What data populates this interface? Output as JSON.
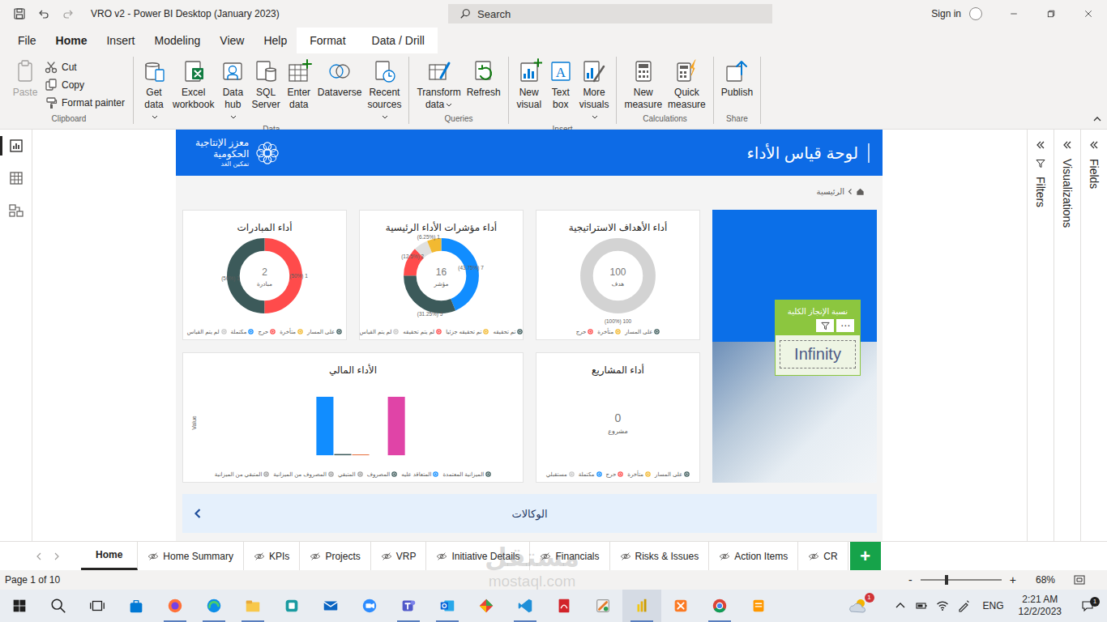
{
  "window": {
    "title": "VRO v2 - Power BI Desktop (January 2023)",
    "search_placeholder": "Search",
    "sign_in": "Sign in"
  },
  "ribbon_tabs": [
    {
      "label": "File",
      "selected": false,
      "contextual": false
    },
    {
      "label": "Home",
      "selected": true,
      "contextual": false
    },
    {
      "label": "Insert",
      "selected": false,
      "contextual": false
    },
    {
      "label": "Modeling",
      "selected": false,
      "contextual": false
    },
    {
      "label": "View",
      "selected": false,
      "contextual": false
    },
    {
      "label": "Help",
      "selected": false,
      "contextual": false
    },
    {
      "label": "Format",
      "selected": false,
      "contextual": true
    },
    {
      "label": "Data / Drill",
      "selected": false,
      "contextual": true
    }
  ],
  "ribbon_groups": [
    {
      "label": "Clipboard",
      "buttons": [
        {
          "label": "Paste",
          "kind": "large",
          "disabled": true,
          "dropdown": false
        },
        {
          "label": "Cut",
          "kind": "small",
          "disabled": false,
          "dropdown": false
        },
        {
          "label": "Copy",
          "kind": "small",
          "disabled": false,
          "dropdown": false
        },
        {
          "label": "Format painter",
          "kind": "small",
          "disabled": false,
          "dropdown": false
        }
      ]
    },
    {
      "label": "Data",
      "buttons": [
        {
          "label": "Get data",
          "kind": "large",
          "disabled": false,
          "dropdown": true
        },
        {
          "label": "Excel workbook",
          "kind": "large",
          "disabled": false,
          "dropdown": false
        },
        {
          "label": "Data hub",
          "kind": "large",
          "disabled": false,
          "dropdown": true
        },
        {
          "label": "SQL Server",
          "kind": "large",
          "disabled": false,
          "dropdown": false
        },
        {
          "label": "Enter data",
          "kind": "large",
          "disabled": false,
          "dropdown": false
        },
        {
          "label": "Dataverse",
          "kind": "large",
          "disabled": false,
          "dropdown": false
        },
        {
          "label": "Recent sources",
          "kind": "large",
          "disabled": false,
          "dropdown": true
        }
      ]
    },
    {
      "label": "Queries",
      "buttons": [
        {
          "label": "Transform data",
          "kind": "large",
          "disabled": false,
          "dropdown": true
        },
        {
          "label": "Refresh",
          "kind": "large",
          "disabled": false,
          "dropdown": false
        }
      ]
    },
    {
      "label": "Insert",
      "buttons": [
        {
          "label": "New visual",
          "kind": "large",
          "disabled": false,
          "dropdown": false
        },
        {
          "label": "Text box",
          "kind": "large",
          "disabled": false,
          "dropdown": false,
          "glyph": "A"
        },
        {
          "label": "More visuals",
          "kind": "large",
          "disabled": false,
          "dropdown": true
        }
      ]
    },
    {
      "label": "Calculations",
      "buttons": [
        {
          "label": "New measure",
          "kind": "large",
          "disabled": false,
          "dropdown": false
        },
        {
          "label": "Quick measure",
          "kind": "large",
          "disabled": false,
          "dropdown": false
        }
      ]
    },
    {
      "label": "Share",
      "buttons": [
        {
          "label": "Publish",
          "kind": "large",
          "disabled": false,
          "dropdown": false
        }
      ]
    }
  ],
  "left_nav": [
    {
      "selected": true
    },
    {
      "selected": false
    },
    {
      "selected": false
    }
  ],
  "panes": [
    {
      "label": "Filters"
    },
    {
      "label": "Visualizations"
    },
    {
      "label": "Fields"
    }
  ],
  "report": {
    "title": "لوحة قياس الأداء",
    "logo_lines": [
      "معزز الإنتاجية",
      "الحكومية",
      "تمكين الغد"
    ],
    "breadcrumb": "الرئيسية",
    "overall": {
      "title": "نسبة الإنجاز الكلية",
      "value": "Infinity",
      "more": "⋯"
    },
    "donuts": [
      {
        "title": "أداء الأهداف الاستراتيجية",
        "center_value": "100",
        "center_unit": "هدف",
        "segments": [
          {
            "value": 100,
            "label": "100 (100%)",
            "color": "#D3D3D3"
          }
        ],
        "legend": [
          {
            "label": "على المسار",
            "color": "#3C5A5A"
          },
          {
            "label": "متأخرة",
            "color": "#F2B931"
          },
          {
            "label": "حرج",
            "color": "#FF4B4B"
          }
        ]
      },
      {
        "title": "أداء مؤشرات الأداء الرئيسية",
        "center_value": "16",
        "center_unit": "مؤشر",
        "segments": [
          {
            "value": 7,
            "label": "7 (43.75%)",
            "color": "#118DFF"
          },
          {
            "value": 5,
            "label": "5 (31.25%)",
            "color": "#3C5A5A"
          },
          {
            "value": 2,
            "label": "2 (12.5%)",
            "color": "#FF4B4B"
          },
          {
            "value": 1,
            "label": "1 (6.25%)",
            "color": "#E0E0E0"
          },
          {
            "value": 1,
            "color": "#F2B931"
          }
        ],
        "legend": [
          {
            "label": "تم تحقيقه",
            "color": "#3C5A5A"
          },
          {
            "label": "تم تحقيقه جزئيا",
            "color": "#F2B931"
          },
          {
            "label": "لم يتم تحقيقه",
            "color": "#FF4B4B"
          },
          {
            "label": "لم يتم القياس",
            "color": "#C8C8C8"
          }
        ]
      },
      {
        "title": "أداء المبادرات",
        "center_value": "2",
        "center_unit": "مبادرة",
        "segments": [
          {
            "value": 1,
            "label": "1 (50%)",
            "color": "#FF4B4B"
          },
          {
            "value": 1,
            "label": "1 (50%)",
            "color": "#3C5A5A"
          }
        ],
        "legend": [
          {
            "label": "على المسار",
            "color": "#3C5A5A"
          },
          {
            "label": "متأخرة",
            "color": "#F2B931"
          },
          {
            "label": "حرج",
            "color": "#FF4B4B"
          },
          {
            "label": "مكتملة",
            "color": "#118DFF"
          },
          {
            "label": "لم يتم القياس",
            "color": "#C8C8C8"
          }
        ]
      }
    ],
    "projects": {
      "title": "أداء المشاريع",
      "center_value": "0",
      "center_unit": "مشروع",
      "legend": [
        {
          "label": "على المسار",
          "color": "#3C5A5A"
        },
        {
          "label": "متأخرة",
          "color": "#F2B931"
        },
        {
          "label": "حرج",
          "color": "#FF4B4B"
        },
        {
          "label": "مكتملة",
          "color": "#118DFF"
        },
        {
          "label": "مستقبلي",
          "color": "#C8C8C8"
        }
      ]
    },
    "financial": {
      "title": "الأداء المالي",
      "axis_label": "Value",
      "bars": [
        {
          "value": 72,
          "color": "#118DFF"
        },
        {
          "value": 1.5,
          "color": "#3C5A5A"
        },
        {
          "value": 1,
          "color": "#E66C37"
        },
        {
          "value": 0,
          "color": "#A0A0A0"
        },
        {
          "value": 72,
          "color": "#E044A7"
        }
      ],
      "legend": [
        {
          "label": "الميزانية المعتمدة",
          "color": "#3C5A5A"
        },
        {
          "label": "المتعاقد عليه",
          "color": "#118DFF"
        },
        {
          "label": "المصروف",
          "color": "#3C5A5A"
        },
        {
          "label": "المتبقي",
          "color": "#A0A0A0"
        },
        {
          "label": "المصروف من الميزانية",
          "color": "#A0A0A0"
        },
        {
          "label": "المتبقي من الميزانية",
          "color": "#A0A0A0"
        }
      ]
    },
    "agencies": "الوكالات"
  },
  "pages": [
    {
      "label": "Home",
      "selected": true,
      "hidden": false
    },
    {
      "label": "Home Summary",
      "selected": false,
      "hidden": true
    },
    {
      "label": "KPIs",
      "selected": false,
      "hidden": true
    },
    {
      "label": "Projects",
      "selected": false,
      "hidden": true
    },
    {
      "label": "VRP",
      "selected": false,
      "hidden": true
    },
    {
      "label": "Initiative Details",
      "selected": false,
      "hidden": true
    },
    {
      "label": "Financials",
      "selected": false,
      "hidden": true
    },
    {
      "label": "Risks & Issues",
      "selected": false,
      "hidden": true
    },
    {
      "label": "Action Items",
      "selected": false,
      "hidden": true
    },
    {
      "label": "CR",
      "selected": false,
      "hidden": true
    }
  ],
  "add_page": "+",
  "status_bar": {
    "page": "Page 1 of 10",
    "zoom_out": "-",
    "zoom_in": "+",
    "zoom": "68%",
    "zoom_level": 0.32
  },
  "taskbar": {
    "apps": [
      {
        "running": false,
        "active": false
      },
      {
        "running": true,
        "active": false
      },
      {
        "running": true,
        "active": false
      },
      {
        "running": true,
        "active": false
      },
      {
        "running": false,
        "active": false
      },
      {
        "running": false,
        "active": false
      },
      {
        "running": false,
        "active": false
      },
      {
        "running": true,
        "active": false
      },
      {
        "running": true,
        "active": false
      },
      {
        "running": false,
        "active": false
      },
      {
        "running": true,
        "active": false
      },
      {
        "running": false,
        "active": false
      },
      {
        "running": false,
        "active": false
      },
      {
        "running": true,
        "active": true
      },
      {
        "running": false,
        "active": false
      },
      {
        "running": true,
        "active": false
      },
      {
        "running": false,
        "active": false
      }
    ],
    "weather_badge": "1",
    "language": "ENG",
    "time": "2:21 AM",
    "date": "12/2/2023",
    "notification_badge": "1"
  },
  "watermark": {
    "arabic": "مستقل",
    "latin": "mostaql.com"
  }
}
